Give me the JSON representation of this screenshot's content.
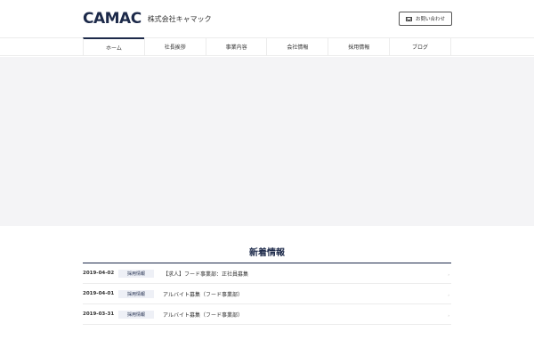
{
  "header": {
    "logo_mark": "CAMAC",
    "logo_text": "株式会社キャマック",
    "contact_label": "お問い合わせ"
  },
  "nav": {
    "items": [
      {
        "label": "ホーム"
      },
      {
        "label": "社長挨拶"
      },
      {
        "label": "事業内容"
      },
      {
        "label": "会社情報"
      },
      {
        "label": "採用情報"
      },
      {
        "label": "ブログ"
      }
    ]
  },
  "news": {
    "title": "新着情報",
    "items": [
      {
        "date": "2019-04-02",
        "category": "採用情報",
        "text": "【求人】フード事業部：正社員募集"
      },
      {
        "date": "2019-04-01",
        "category": "採用情報",
        "text": "アルバイト募集（フード事業部）"
      },
      {
        "date": "2019-03-31",
        "category": "採用情報",
        "text": "アルバイト募集（フード事業部）"
      }
    ]
  },
  "colors": {
    "brand": "#1d2a4a",
    "hero_bg": "#f4f4f6"
  }
}
